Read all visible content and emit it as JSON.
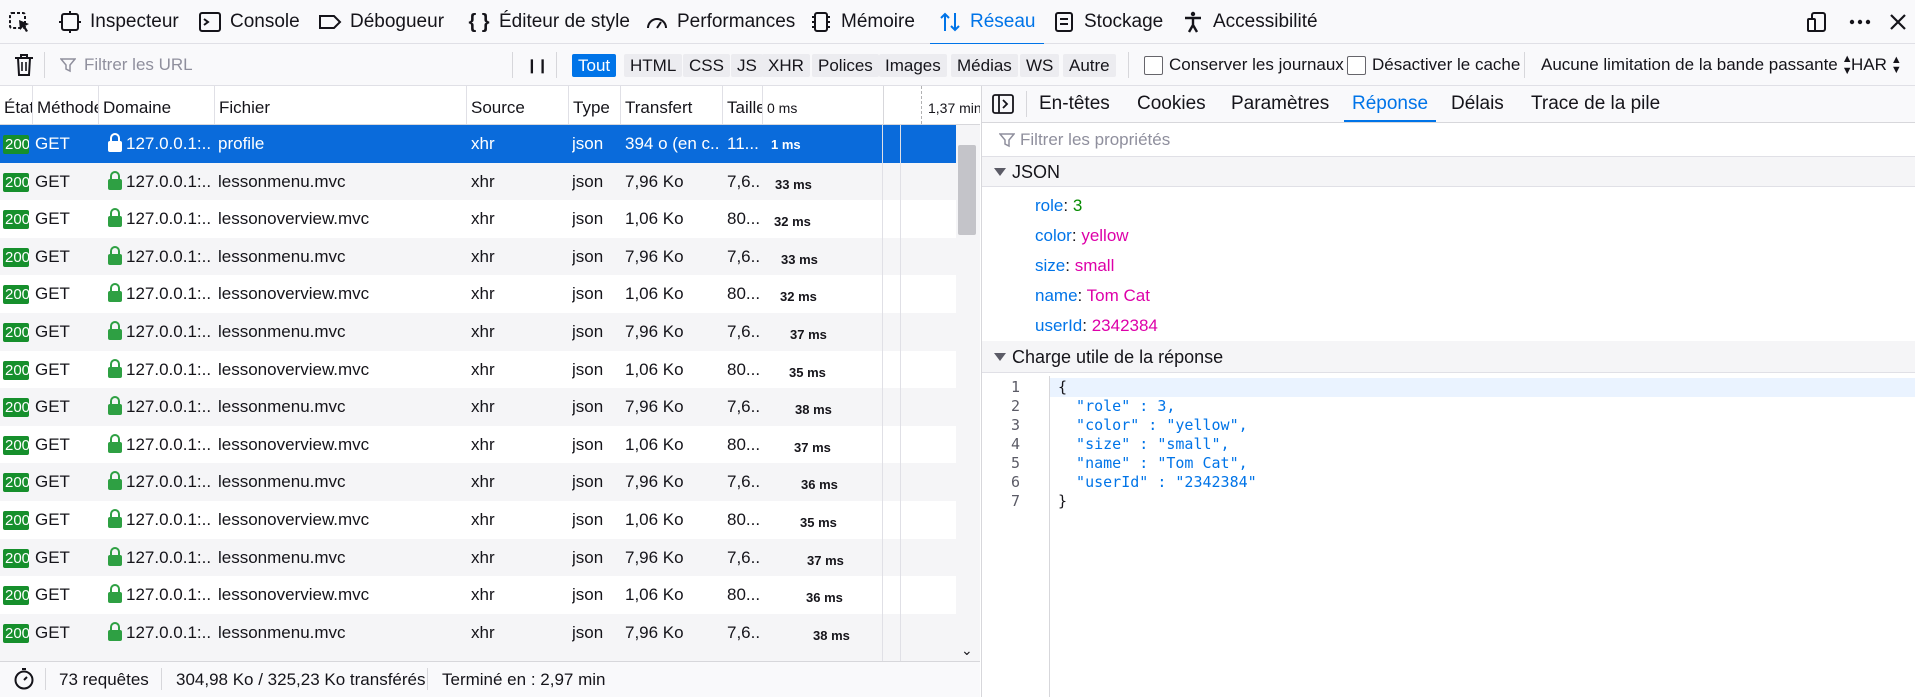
{
  "toolbar": {
    "tools": [
      {
        "name": "inspector",
        "label": "Inspecteur"
      },
      {
        "name": "console",
        "label": "Console"
      },
      {
        "name": "debugger",
        "label": "Débogueur"
      },
      {
        "name": "style-editor",
        "label": "Éditeur de style"
      },
      {
        "name": "performance",
        "label": "Performances"
      },
      {
        "name": "memory",
        "label": "Mémoire"
      },
      {
        "name": "network",
        "label": "Réseau"
      },
      {
        "name": "storage",
        "label": "Stockage"
      },
      {
        "name": "accessibility",
        "label": "Accessibilité"
      }
    ],
    "selected": "Réseau"
  },
  "filterbar": {
    "url_placeholder": "Filtrer les URL",
    "pause_label": "❙❙",
    "types": [
      "Tout",
      "HTML",
      "CSS",
      "JS",
      "XHR",
      "Polices",
      "Images",
      "Médias",
      "WS",
      "Autre"
    ],
    "active_type": "Tout",
    "persist_logs": "Conserver les journaux",
    "disable_cache": "Désactiver le cache",
    "throttling": "Aucune limitation de la bande passante",
    "har": "HAR"
  },
  "table": {
    "headers": {
      "status": "État",
      "method": "Méthode",
      "domain": "Domaine",
      "file": "Fichier",
      "source": "Source",
      "type": "Type",
      "transfer": "Transfert",
      "size": "Taille",
      "waterfall_start": "0 ms",
      "waterfall_end": "1,37 min"
    },
    "rows": [
      {
        "status": "200",
        "method": "GET",
        "domain": "127.0.0.1:...",
        "file": "profile",
        "source": "xhr",
        "type": "json",
        "transfer": "394 o (en c...",
        "size": "11...",
        "timing": "1 ms"
      },
      {
        "status": "200",
        "method": "GET",
        "domain": "127.0.0.1:...",
        "file": "lessonmenu.mvc",
        "source": "xhr",
        "type": "json",
        "transfer": "7,96 Ko",
        "size": "7,6...",
        "timing": "33 ms"
      },
      {
        "status": "200",
        "method": "GET",
        "domain": "127.0.0.1:...",
        "file": "lessonoverview.mvc",
        "source": "xhr",
        "type": "json",
        "transfer": "1,06 Ko",
        "size": "80...",
        "timing": "32 ms"
      },
      {
        "status": "200",
        "method": "GET",
        "domain": "127.0.0.1:...",
        "file": "lessonmenu.mvc",
        "source": "xhr",
        "type": "json",
        "transfer": "7,96 Ko",
        "size": "7,6...",
        "timing": "33 ms"
      },
      {
        "status": "200",
        "method": "GET",
        "domain": "127.0.0.1:...",
        "file": "lessonoverview.mvc",
        "source": "xhr",
        "type": "json",
        "transfer": "1,06 Ko",
        "size": "80...",
        "timing": "32 ms"
      },
      {
        "status": "200",
        "method": "GET",
        "domain": "127.0.0.1:...",
        "file": "lessonmenu.mvc",
        "source": "xhr",
        "type": "json",
        "transfer": "7,96 Ko",
        "size": "7,6...",
        "timing": "37 ms"
      },
      {
        "status": "200",
        "method": "GET",
        "domain": "127.0.0.1:...",
        "file": "lessonoverview.mvc",
        "source": "xhr",
        "type": "json",
        "transfer": "1,06 Ko",
        "size": "80...",
        "timing": "35 ms"
      },
      {
        "status": "200",
        "method": "GET",
        "domain": "127.0.0.1:...",
        "file": "lessonmenu.mvc",
        "source": "xhr",
        "type": "json",
        "transfer": "7,96 Ko",
        "size": "7,6...",
        "timing": "38 ms"
      },
      {
        "status": "200",
        "method": "GET",
        "domain": "127.0.0.1:...",
        "file": "lessonoverview.mvc",
        "source": "xhr",
        "type": "json",
        "transfer": "1,06 Ko",
        "size": "80...",
        "timing": "37 ms"
      },
      {
        "status": "200",
        "method": "GET",
        "domain": "127.0.0.1:...",
        "file": "lessonmenu.mvc",
        "source": "xhr",
        "type": "json",
        "transfer": "7,96 Ko",
        "size": "7,6...",
        "timing": "36 ms"
      },
      {
        "status": "200",
        "method": "GET",
        "domain": "127.0.0.1:...",
        "file": "lessonoverview.mvc",
        "source": "xhr",
        "type": "json",
        "transfer": "1,06 Ko",
        "size": "80...",
        "timing": "35 ms"
      },
      {
        "status": "200",
        "method": "GET",
        "domain": "127.0.0.1:...",
        "file": "lessonmenu.mvc",
        "source": "xhr",
        "type": "json",
        "transfer": "7,96 Ko",
        "size": "7,6...",
        "timing": "37 ms"
      },
      {
        "status": "200",
        "method": "GET",
        "domain": "127.0.0.1:...",
        "file": "lessonoverview.mvc",
        "source": "xhr",
        "type": "json",
        "transfer": "1,06 Ko",
        "size": "80...",
        "timing": "36 ms"
      },
      {
        "status": "200",
        "method": "GET",
        "domain": "127.0.0.1:...",
        "file": "lessonmenu.mvc",
        "source": "xhr",
        "type": "json",
        "transfer": "7,96 Ko",
        "size": "7,6...",
        "timing": "38 ms"
      }
    ]
  },
  "statusbar": {
    "requests": "73 requêtes",
    "size": "304,98 Ko / 325,23 Ko transférés",
    "finished": "Terminé en : 2,97 min"
  },
  "details": {
    "tabs": [
      "En-têtes",
      "Cookies",
      "Paramètres",
      "Réponse",
      "Délais",
      "Trace de la pile"
    ],
    "active_tab": "Réponse",
    "filter_placeholder": "Filtrer les propriétés",
    "json_section": "JSON",
    "props": [
      {
        "key": "role",
        "value": "3",
        "kind": "num"
      },
      {
        "key": "color",
        "value": "yellow",
        "kind": "str"
      },
      {
        "key": "size",
        "value": "small",
        "kind": "str"
      },
      {
        "key": "name",
        "value": "Tom Cat",
        "kind": "str"
      },
      {
        "key": "userId",
        "value": "2342384",
        "kind": "str"
      }
    ],
    "payload_section": "Charge utile de la réponse",
    "code_lines": [
      "{",
      "  \"role\" : 3,",
      "  \"color\" : \"yellow\",",
      "  \"size\" : \"small\",",
      "  \"name\" : \"Tom Cat\",",
      "  \"userId\" : \"2342384\"",
      "}"
    ]
  },
  "colors": {
    "accent": "#0074e8",
    "selected_row": "#0a6bdb",
    "status_ok": "#168f2c",
    "json_string": "#dd00a9",
    "json_number": "#058b00"
  }
}
